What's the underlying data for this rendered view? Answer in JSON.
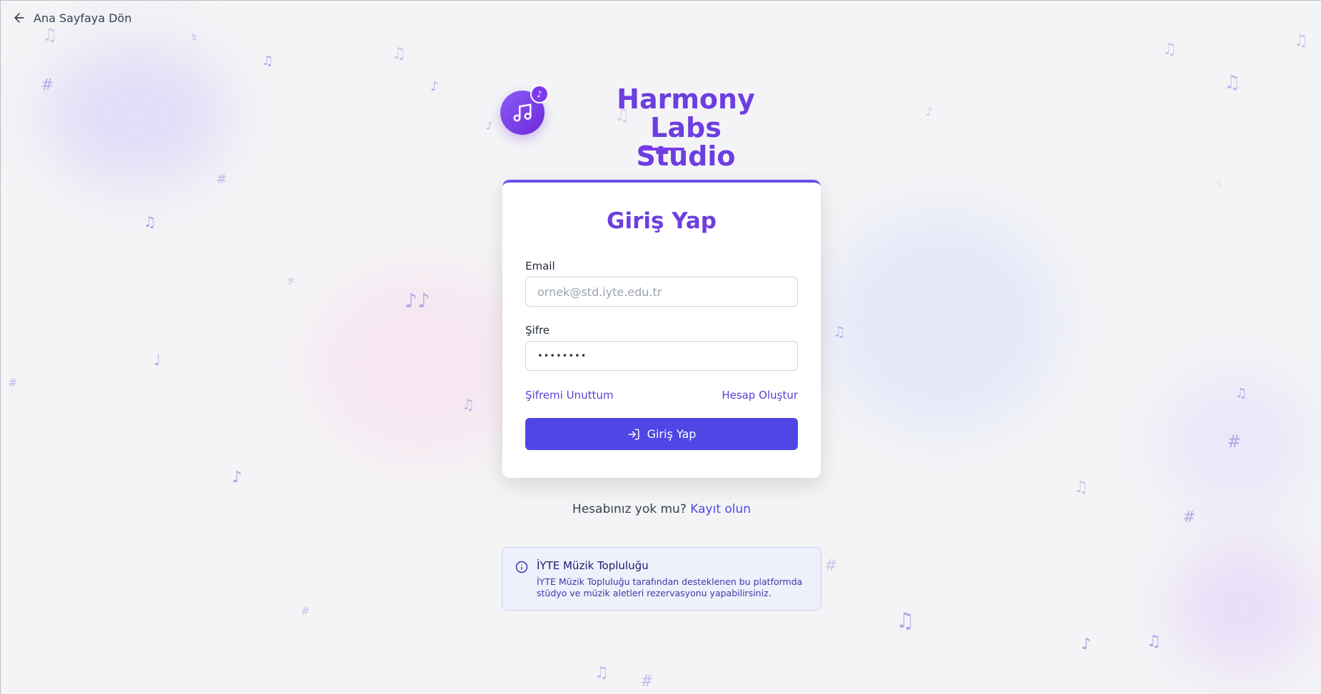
{
  "nav": {
    "back_label": "Ana Sayfaya Dön"
  },
  "brand": {
    "title_line1": "Harmony Labs",
    "title_line2": "Studio",
    "badge_glyph": "♪"
  },
  "login": {
    "heading": "Giriş Yap",
    "email_label": "Email",
    "email_placeholder": "ornek@std.iyte.edu.tr",
    "email_value": "",
    "password_label": "Şifre",
    "password_value": "••••••••",
    "forgot_link": "Şifremi Unuttum",
    "create_account_link": "Hesap Oluştur",
    "submit_label": "Giriş Yap"
  },
  "signup_prompt": {
    "text": "Hesabınız yok mu?",
    "link": "Kayıt olun"
  },
  "info": {
    "title": "İYTE Müzik Topluluğu",
    "text": "İYTE Müzik Topluluğu tarafından desteklenen bu platformda stüdyo ve müzik aletleri rezervasyonu yapabilirsiniz."
  },
  "colors": {
    "accent": "#4f46e5",
    "brand_purple": "#6d3ee0",
    "background": "#f4f4f6",
    "info_bg": "#eef0fb"
  },
  "icons": [
    "arrow-left-icon",
    "music-notes-icon",
    "login-icon",
    "info-icon"
  ]
}
